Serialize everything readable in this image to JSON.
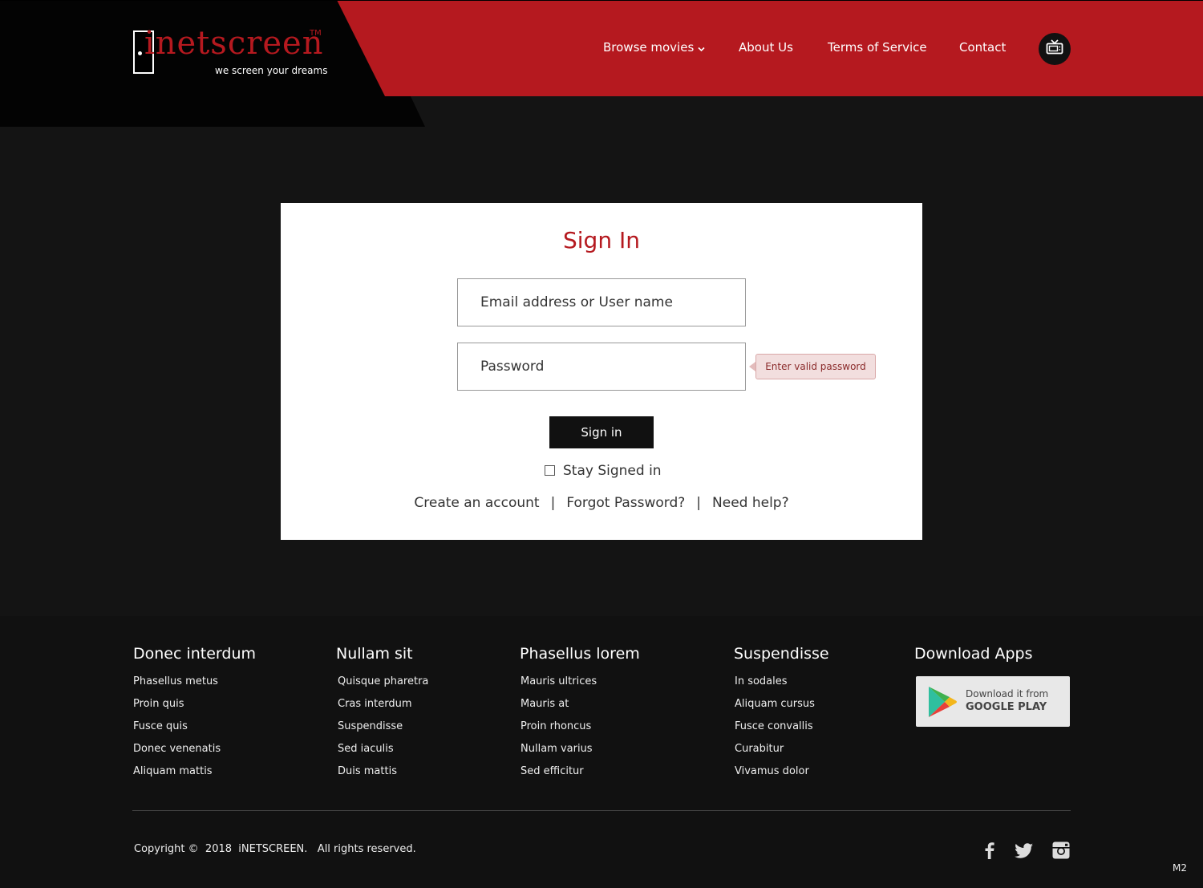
{
  "header": {
    "logo": {
      "wordmark": "inetscreen",
      "tm": "TM",
      "tagline": "we screen your dreams"
    },
    "nav": [
      {
        "label": "Browse movies"
      },
      {
        "label": "About Us"
      },
      {
        "label": "Terms of Service"
      },
      {
        "label": "Contact"
      }
    ],
    "tv_icon": "tv-icon",
    "colors": {
      "brand_red": "#b5191f",
      "black": "#030303"
    }
  },
  "signin": {
    "title": "Sign In",
    "email_placeholder": "Email address or User name",
    "password_placeholder": "Password",
    "password_error": "Enter valid password",
    "submit_label": "Sign in",
    "stay_signed_in_label": "Stay Signed in",
    "stay_signed_in_checked": false,
    "links": {
      "create_account": "Create an account",
      "separator": "|",
      "forgot_password": "Forgot Password?",
      "need_help": "Need help?"
    }
  },
  "footer": {
    "columns": [
      {
        "title": "Donec interdum",
        "items": [
          "Phasellus metus",
          "Proin quis",
          "Fusce quis",
          "Donec venenatis",
          "Aliquam mattis"
        ]
      },
      {
        "title": "Nullam sit",
        "items": [
          "Quisque pharetra",
          "Cras interdum",
          "Suspendisse",
          "Sed iaculis",
          "Duis mattis"
        ]
      },
      {
        "title": "Phasellus lorem",
        "items": [
          "Mauris ultrices",
          "Mauris at",
          "Proin rhoncus",
          "Nullam varius",
          "Sed efficitur"
        ]
      },
      {
        "title": "Suspendisse",
        "items": [
          "In sodales",
          "Aliquam cursus",
          "Fusce convallis",
          "Curabitur",
          "Vivamus dolor"
        ]
      }
    ],
    "apps": {
      "title": "Download Apps",
      "google_play_line1": "Download it from",
      "google_play_line2": "GOOGLE PLAY",
      "icon": "google-play-icon"
    },
    "copyright": "Copyright ©  2018  iNETSCREEN.   All rights reserved.",
    "social_icons": [
      "facebook-icon",
      "twitter-icon",
      "instagram-icon"
    ],
    "version": "M2"
  }
}
